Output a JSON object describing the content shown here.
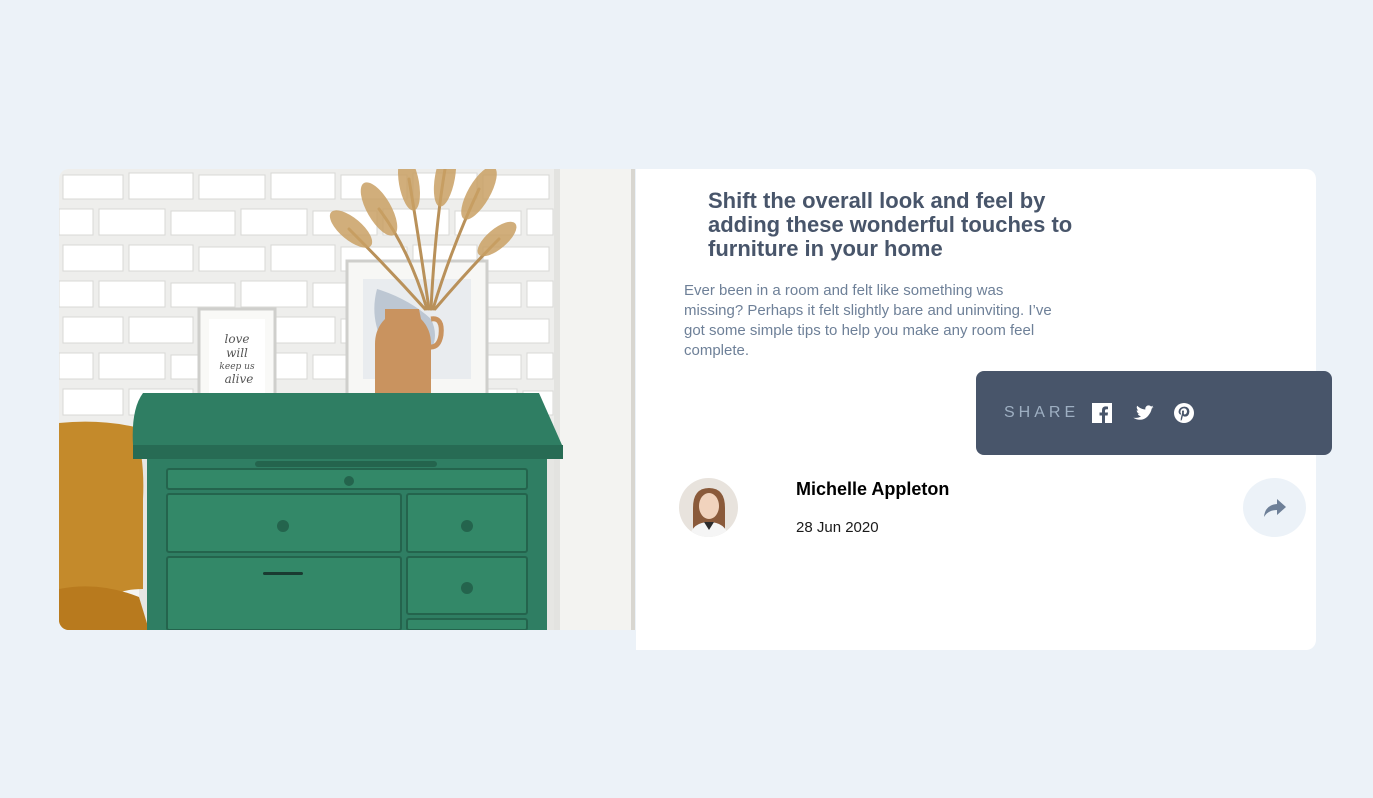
{
  "article": {
    "title": "Shift the overall look and feel by adding these wonderful touches to furniture in your home",
    "excerpt": "Ever been in a room and felt like something was missing? Perhaps it felt slightly bare and uninviting. I’ve got some simple tips to help you make any room feel complete.",
    "image_frame_text": "love will keep us alive"
  },
  "author": {
    "name": "Michelle Appleton",
    "date": "28 Jun 2020"
  },
  "share": {
    "label": "SHARE",
    "icons": [
      "facebook-icon",
      "twitter-icon",
      "pinterest-icon"
    ]
  },
  "colors": {
    "background": "#ecf2f8",
    "heading": "#48556a",
    "body_text": "#6e8098",
    "share_panel": "#48556a",
    "share_label": "#9eafc2",
    "dresser_green": "#2f7e63",
    "vase": "#c9935f"
  }
}
